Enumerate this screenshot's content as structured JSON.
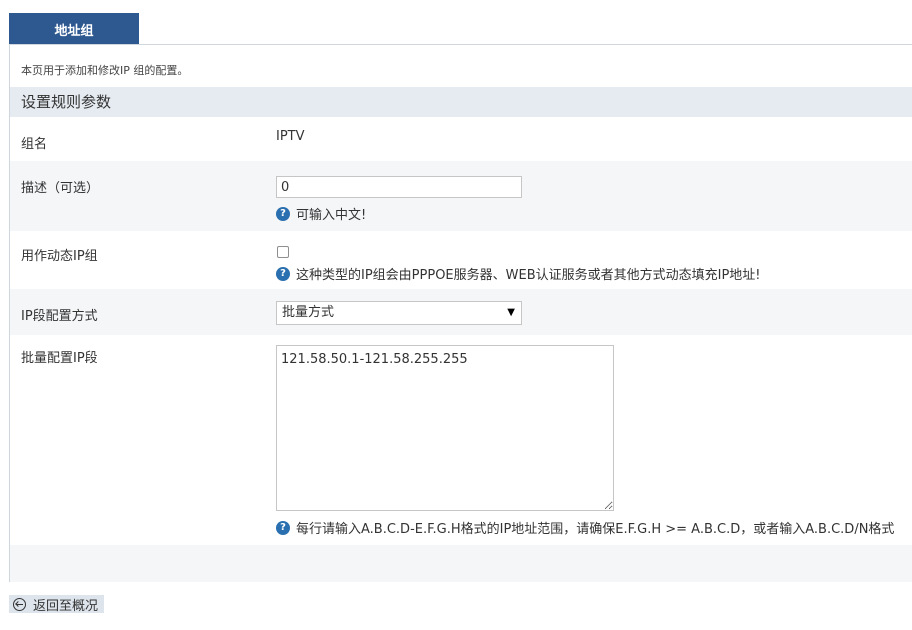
{
  "tab": {
    "label": "地址组"
  },
  "description": "本页用于添加和修改IP 组的配置。",
  "section": {
    "title": "设置规则参数"
  },
  "fields": {
    "group_name": {
      "label": "组名",
      "value": "IPTV"
    },
    "description": {
      "label": "描述（可选）",
      "value": "0",
      "hint": "可输入中文!"
    },
    "dynamic": {
      "label": "用作动态IP组",
      "checked": false,
      "hint": "这种类型的IP组会由PPPOE服务器、WEB认证服务或者其他方式动态填充IP地址!"
    },
    "ip_mode": {
      "label": "IP段配置方式",
      "selected": "批量方式"
    },
    "ip_batch": {
      "label": "批量配置IP段",
      "value": "121.58.50.1-121.58.255.255",
      "hint": "每行请输入A.B.C.D-E.F.G.H格式的IP地址范围，请确保E.F.G.H >= A.B.C.D，或者输入A.B.C.D/N格式"
    }
  },
  "footer": {
    "back_label": "返回至概况"
  },
  "icons": {
    "hint": "question-circle-icon",
    "back": "circle-arrow-left-icon"
  },
  "colors": {
    "tab_bg": "#2e5890",
    "section_bg": "#e6ebf1",
    "hint_icon": "#2a6fb0"
  }
}
